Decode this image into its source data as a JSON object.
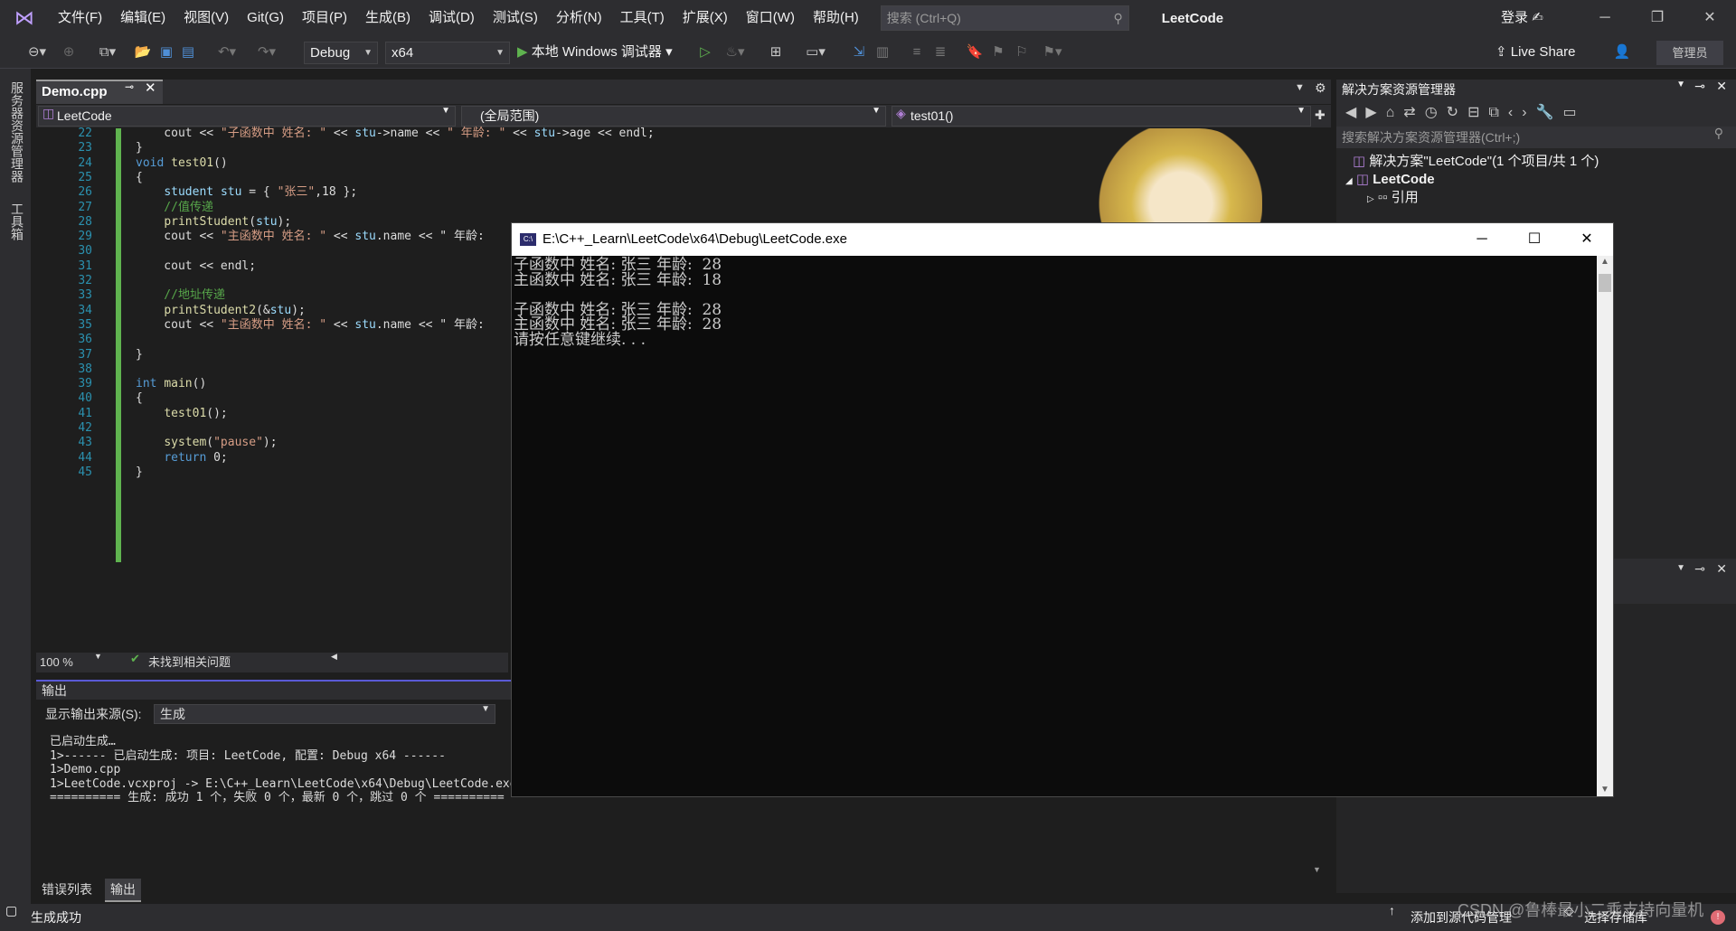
{
  "menu": {
    "items": [
      "文件(F)",
      "编辑(E)",
      "视图(V)",
      "Git(G)",
      "项目(P)",
      "生成(B)",
      "调试(D)",
      "测试(S)",
      "分析(N)",
      "工具(T)",
      "扩展(X)",
      "窗口(W)",
      "帮助(H)"
    ],
    "search_placeholder": "搜索 (Ctrl+Q)",
    "app_title": "LeetCode",
    "login": "登录"
  },
  "toolbar": {
    "config": "Debug",
    "platform": "x64",
    "run_label": "本地 Windows 调试器",
    "live_share": "Live Share",
    "admin": "管理员"
  },
  "left_tabs": [
    "服务器资源管理器",
    "工具箱"
  ],
  "editor": {
    "tab": "Demo.cpp",
    "nav_project": "LeetCode",
    "nav_scope": "(全局范围)",
    "nav_func": "test01()",
    "zoom": "100 %",
    "issues": "未找到相关问题",
    "lines": [
      {
        "n": "22",
        "t": "    cout << \"子函数中 姓名: \" << stu->name << \" 年龄: \" << stu->age << endl;"
      },
      {
        "n": "23",
        "t": "}"
      },
      {
        "n": "24",
        "t": "void test01()"
      },
      {
        "n": "25",
        "t": "{"
      },
      {
        "n": "26",
        "t": "    student stu = { \"张三\",18 };"
      },
      {
        "n": "27",
        "t": "    //值传递"
      },
      {
        "n": "28",
        "t": "    printStudent(stu);"
      },
      {
        "n": "29",
        "t": "    cout << \"主函数中 姓名: \" << stu.name << \" 年龄:"
      },
      {
        "n": "30",
        "t": ""
      },
      {
        "n": "31",
        "t": "    cout << endl;"
      },
      {
        "n": "32",
        "t": ""
      },
      {
        "n": "33",
        "t": "    //地址传递"
      },
      {
        "n": "34",
        "t": "    printStudent2(&stu);"
      },
      {
        "n": "35",
        "t": "    cout << \"主函数中 姓名: \" << stu.name << \" 年龄:"
      },
      {
        "n": "36",
        "t": ""
      },
      {
        "n": "37",
        "t": "}"
      },
      {
        "n": "38",
        "t": ""
      },
      {
        "n": "39",
        "t": "int main()"
      },
      {
        "n": "40",
        "t": "{"
      },
      {
        "n": "41",
        "t": "    test01();"
      },
      {
        "n": "42",
        "t": ""
      },
      {
        "n": "43",
        "t": "    system(\"pause\");"
      },
      {
        "n": "44",
        "t": "    return 0;"
      },
      {
        "n": "45",
        "t": "}"
      }
    ]
  },
  "output": {
    "title": "输出",
    "source_label": "显示输出来源(S):",
    "source_value": "生成",
    "lines": [
      "已启动生成…",
      "1>------ 已启动生成: 项目: LeetCode, 配置: Debug x64 ------",
      "1>Demo.cpp",
      "1>LeetCode.vcxproj -> E:\\C++_Learn\\LeetCode\\x64\\Debug\\LeetCode.exe",
      "========== 生成: 成功 1 个，失败 0 个，最新 0 个，跳过 0 个 =========="
    ],
    "tabs": [
      "错误列表",
      "输出"
    ]
  },
  "solution": {
    "title": "解决方案资源管理器",
    "search_placeholder": "搜索解决方案资源管理器(Ctrl+;)",
    "solution_node": "解决方案\"LeetCode\"(1 个项目/共 1 个)",
    "project_node": "LeetCode",
    "ref_node": "引用"
  },
  "console": {
    "title": "E:\\C++_Learn\\LeetCode\\x64\\Debug\\LeetCode.exe",
    "icon_text": "C:\\",
    "lines": [
      "子函数中 姓名: 张三 年龄:  28",
      "主函数中 姓名: 张三 年龄:  18",
      "",
      "子函数中 姓名: 张三 年龄:  28",
      "主函数中 姓名: 张三 年龄:  28",
      "请按任意键继续. . ."
    ]
  },
  "status": {
    "left": "生成成功",
    "add_source": "添加到源代码管理",
    "select_repo": "选择存储库",
    "watermark": "CSDN @鲁棒最小二乘支持向量机"
  }
}
